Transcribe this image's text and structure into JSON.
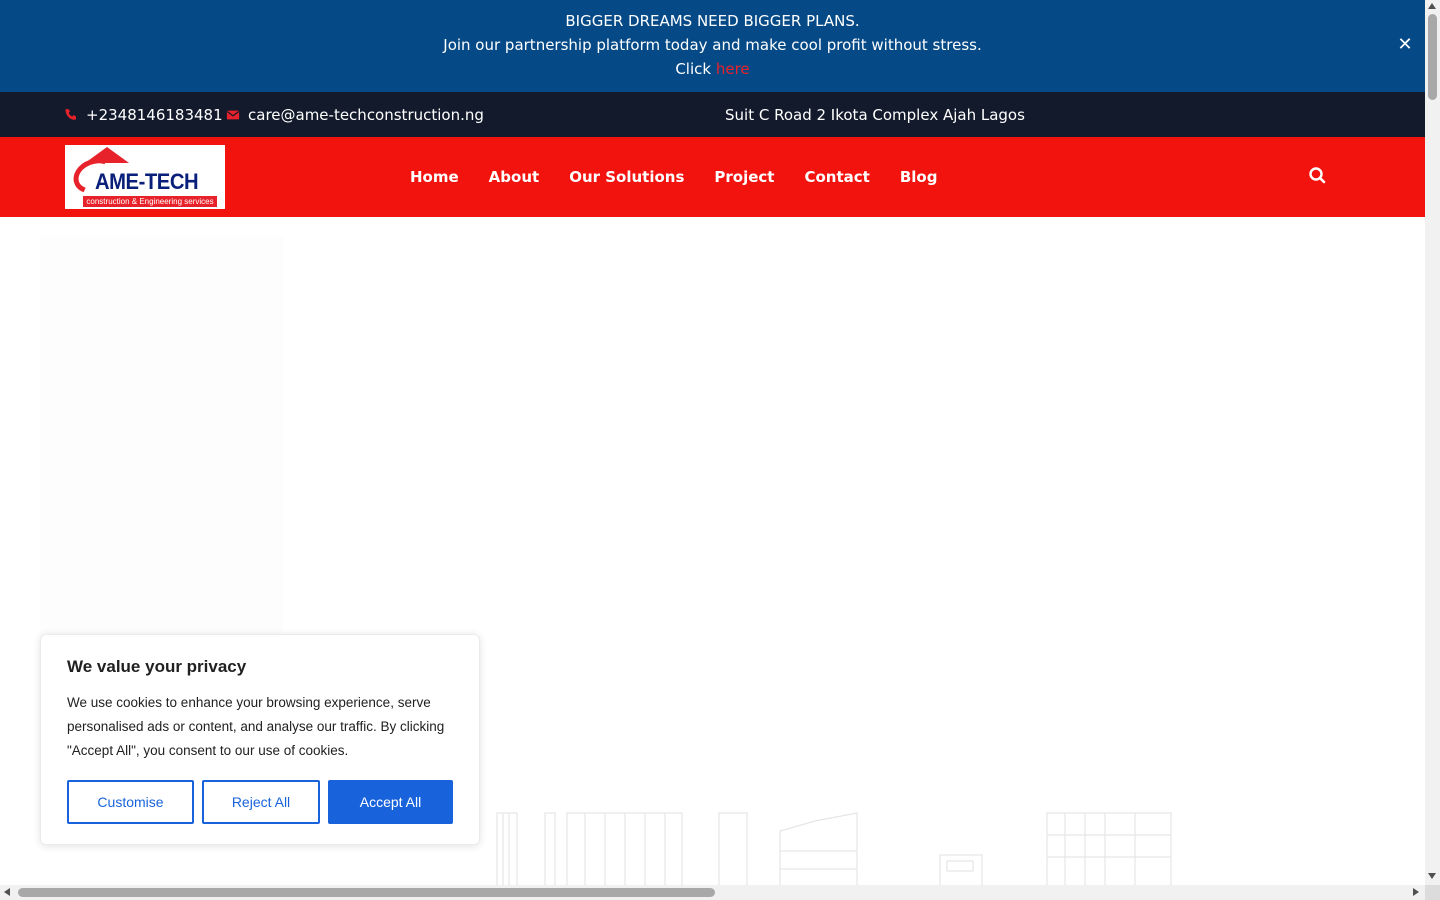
{
  "announcement": {
    "line1": "BIGGER DREAMS NEED BIGGER PLANS.",
    "line2": "Join our partnership platform today and make cool profit without stress.",
    "click_prefix": "Click ",
    "link_text": "here",
    "close_glyph": "✕",
    "background": "#054a86"
  },
  "contact": {
    "phone": "+2348146183481",
    "email": "care@ame-techconstruction.ng",
    "address": "Suit C Road 2 Ikota Complex Ajah Lagos",
    "phone_icon": "phone-icon",
    "email_icon": "envelope-icon",
    "icon_color": "#e8222b"
  },
  "logo": {
    "brand": "AME-TECH",
    "tagline": "construction & Engineering services"
  },
  "nav": {
    "items": [
      {
        "label": "Home"
      },
      {
        "label": "About"
      },
      {
        "label": "Our Solutions"
      },
      {
        "label": "Project"
      },
      {
        "label": "Contact"
      },
      {
        "label": "Blog"
      }
    ],
    "search_icon": "search-icon",
    "background": "#f2130f"
  },
  "cookie": {
    "title": "We value your privacy",
    "body": "We use cookies to enhance your browsing experience, serve personalised ads or content, and analyse our traffic. By clicking \"Accept All\", you consent to our use of cookies.",
    "customise_label": "Customise",
    "reject_label": "Reject All",
    "accept_label": "Accept All",
    "accent": "#1863dc"
  }
}
